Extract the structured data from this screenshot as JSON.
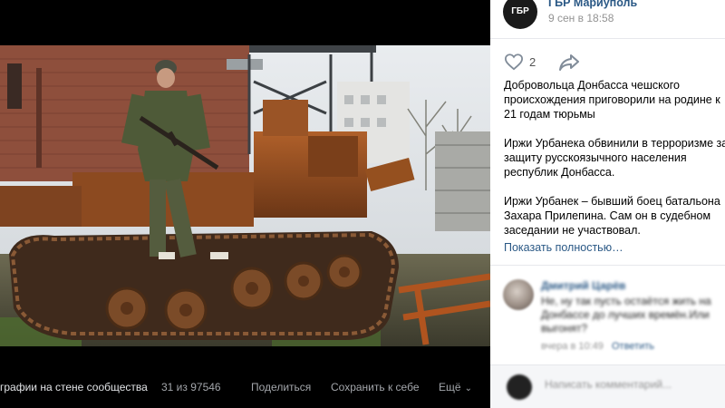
{
  "viewer": {
    "album_label": "графии на стене сообщества",
    "photo_counter": "31 из 97546",
    "share_label": "Поделиться",
    "save_label": "Сохранить к себе",
    "more_label": "Ещё"
  },
  "post": {
    "avatar_text_top": "ГБР",
    "group_name": "ГБР Мариуполь",
    "date": "9 сен в 18:58",
    "like_count": "2",
    "text": "Добровольца Донбасса чешского происхождения приговорили на родине к 21 годам тюрьмы\n\nИржи Урбанека обвинили в терроризме за защиту русскоязычного населения республик Донбасса.\n\nИржи Урбанек – бывший боец батальона Захара Прилепина. Сам он в судебном заседании не участвовал.",
    "show_more": "Показать полностью…"
  },
  "comment": {
    "author": "Дмитрий Царёв",
    "text": "Не, ну так пусть остаётся жить на Донбассе до лучших времён.Или выгонят?",
    "time": "вчера в 10:49",
    "reply": "Ответить"
  },
  "footer": {
    "input_placeholder": "Написать комментарий..."
  },
  "colors": {
    "link": "#2a5885",
    "secondary": "#939393",
    "viewer_bg": "#000000",
    "panel_bg": "#ffffff",
    "rust": "#8a4a1f"
  }
}
